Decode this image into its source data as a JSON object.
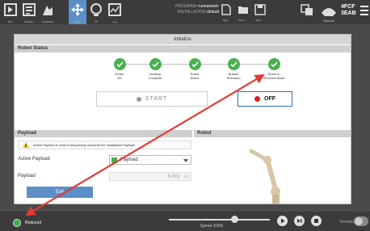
{
  "topbar": {
    "nav": [
      {
        "label": "Run",
        "icon": "run-icon"
      },
      {
        "label": "Program",
        "icon": "program-icon"
      },
      {
        "label": "Installation",
        "icon": "installation-icon"
      },
      {
        "label": "Move",
        "icon": "move-icon",
        "active": true
      },
      {
        "label": "I/O",
        "icon": "io-icon"
      },
      {
        "label": "Log",
        "icon": "log-icon"
      }
    ],
    "program_label": "PROGRAM",
    "program_value": "<unnamed>",
    "installation_label": "INSTALLATION",
    "installation_value": "default",
    "file_buttons": [
      {
        "label": "New...",
        "icon": "new-file-icon"
      },
      {
        "label": "Open...",
        "icon": "open-folder-icon"
      },
      {
        "label": "Save...",
        "icon": "save-icon"
      }
    ],
    "right_icons": [
      "remote-control-icon",
      "manual-mode-icon",
      "menu-icon"
    ],
    "mode_label": "Manual",
    "serial_line1": "4FCF",
    "serial_line2": "3EAB"
  },
  "dialog": {
    "title": "Initialize",
    "robot_status": {
      "heading": "Robot Status",
      "steps": [
        {
          "line1": "Power",
          "line2": "ON"
        },
        {
          "line1": "Booting",
          "line2": "Complete"
        },
        {
          "line1": "Robot",
          "line2": "Active"
        },
        {
          "line1": "Brakes",
          "line2": "Released"
        },
        {
          "line1": "Robot in",
          "line2": "Reduced Mode"
        }
      ],
      "start_label": "START",
      "off_label": "OFF"
    },
    "payload": {
      "heading": "Payload",
      "warning": "Active Payload is used to temporarily overwrite the Installation Payload.",
      "active_payload_label": "Active Payload",
      "active_payload_value": "Payload",
      "payload_label": "Payload",
      "payload_value": "0.001",
      "payload_unit": "kg"
    },
    "robot_heading": "Robot",
    "exit_label": "Exit"
  },
  "bottombar": {
    "status": "Reduced",
    "speed": "Speed 100%",
    "speed_fraction": 1.0,
    "simulation_label": "Simulation"
  },
  "colors": {
    "accent": "#5c8fc7",
    "ok": "#4caf50",
    "stop": "#e0201b",
    "annotation_arrow": "#e53935"
  }
}
